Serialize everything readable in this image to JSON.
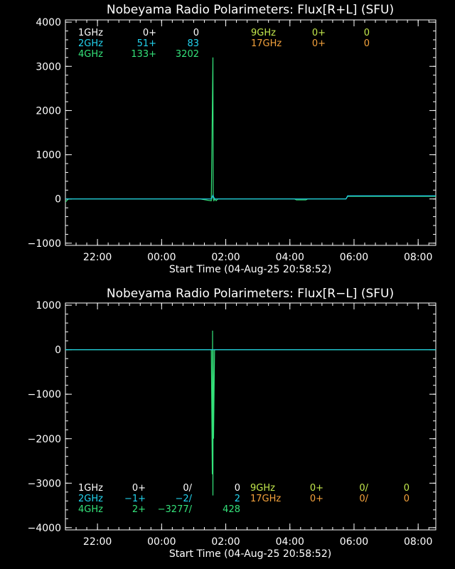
{
  "colors": {
    "background": "#000000",
    "axes": "#ffffff",
    "1GHz": "#ffffff",
    "2GHz": "#22d3ee",
    "4GHz": "#34e27a",
    "9GHz": "#c3e84c",
    "17GHz": "#f4a23c"
  },
  "chart_data": [
    {
      "type": "line",
      "title": "Nobeyama Radio Polarimeters: Flux[R+L] (SFU)",
      "xlabel": "Start Time (04-Aug-25 20:58:52)",
      "ylabel": "",
      "x_unit": "hours since 00:00 on 05-Aug-25",
      "xlim": [
        -3.0,
        8.55
      ],
      "ylim": [
        -1050,
        4050
      ],
      "x_ticks": [
        -2,
        0,
        2,
        4,
        6,
        8
      ],
      "x_tick_labels": [
        "22:00",
        "00:00",
        "02:00",
        "04:00",
        "06:00",
        "08:00"
      ],
      "y_ticks": [
        -1000,
        0,
        1000,
        2000,
        3000,
        4000
      ],
      "y_tick_labels": [
        "−1000",
        "0",
        "1000",
        "2000",
        "3000",
        "4000"
      ],
      "legend_position": "top-left",
      "legend": [
        {
          "label": "1GHz",
          "a": "0+",
          "b": "0",
          "color_key": "1GHz"
        },
        {
          "label": "2GHz",
          "a": "51+",
          "b": "83",
          "color_key": "2GHz"
        },
        {
          "label": "4GHz",
          "a": "133+",
          "b": "3202",
          "color_key": "4GHz"
        },
        {
          "label": "9GHz",
          "a": "0+",
          "b": "0",
          "color_key": "9GHz"
        },
        {
          "label": "17GHz",
          "a": "0+",
          "b": "0",
          "color_key": "17GHz"
        }
      ],
      "series": [
        {
          "name": "4GHz",
          "color_key": "4GHz",
          "x": [
            -3.0,
            -2.95,
            -2.9,
            1.2,
            1.45,
            1.55,
            1.58,
            1.6,
            1.61,
            1.63,
            1.66,
            1.7,
            1.75,
            4.15,
            4.2,
            4.35,
            4.5,
            4.55,
            5.75,
            5.8,
            5.85,
            8.4,
            8.55
          ],
          "y": [
            -70,
            -30,
            0,
            0,
            -30,
            -40,
            1950,
            3202,
            0,
            -40,
            0,
            -40,
            0,
            0,
            -20,
            -20,
            -20,
            0,
            0,
            60,
            60,
            60,
            60
          ]
        },
        {
          "name": "2GHz",
          "color_key": "2GHz",
          "x": [
            -3.0,
            1.55,
            1.6,
            1.65,
            4.2,
            4.5,
            5.75,
            5.8,
            8.55
          ],
          "y": [
            0,
            0,
            83,
            0,
            0,
            0,
            0,
            70,
            70
          ]
        }
      ]
    },
    {
      "type": "line",
      "title": "Nobeyama Radio Polarimeters: Flux[R−L] (SFU)",
      "xlabel": "Start Time (04-Aug-25 20:58:52)",
      "ylabel": "",
      "x_unit": "hours since 00:00 on 05-Aug-25",
      "xlim": [
        -3.0,
        8.55
      ],
      "ylim": [
        -4050,
        1050
      ],
      "x_ticks": [
        -2,
        0,
        2,
        4,
        6,
        8
      ],
      "x_tick_labels": [
        "22:00",
        "00:00",
        "02:00",
        "04:00",
        "06:00",
        "08:00"
      ],
      "y_ticks": [
        -4000,
        -3000,
        -2000,
        -1000,
        0,
        1000
      ],
      "y_tick_labels": [
        "−4000",
        "−3000",
        "−2000",
        "−1000",
        "0",
        "1000"
      ],
      "legend_position": "bottom-left",
      "legend": [
        {
          "label": "1GHz",
          "a": "0+",
          "b": "0/",
          "c": "0",
          "color_key": "1GHz"
        },
        {
          "label": "2GHz",
          "a": "−1+",
          "b": "−2/",
          "c": "2",
          "color_key": "2GHz"
        },
        {
          "label": "4GHz",
          "a": "2+",
          "b": "−3277/",
          "c": "428",
          "color_key": "4GHz"
        },
        {
          "label": "9GHz",
          "a": "0+",
          "b": "0/",
          "c": "0",
          "color_key": "9GHz"
        },
        {
          "label": "17GHz",
          "a": "0+",
          "b": "0/",
          "c": "0",
          "color_key": "17GHz"
        }
      ],
      "series": [
        {
          "name": "4GHz",
          "color_key": "4GHz",
          "x": [
            -3.0,
            1.55,
            1.58,
            1.59,
            1.6,
            1.61,
            1.62,
            1.65,
            8.55
          ],
          "y": [
            0,
            0,
            -2800,
            428,
            -3277,
            0,
            -2000,
            0,
            0
          ]
        },
        {
          "name": "2GHz",
          "color_key": "2GHz",
          "x": [
            -3.0,
            8.55
          ],
          "y": [
            0,
            0
          ]
        }
      ]
    }
  ]
}
